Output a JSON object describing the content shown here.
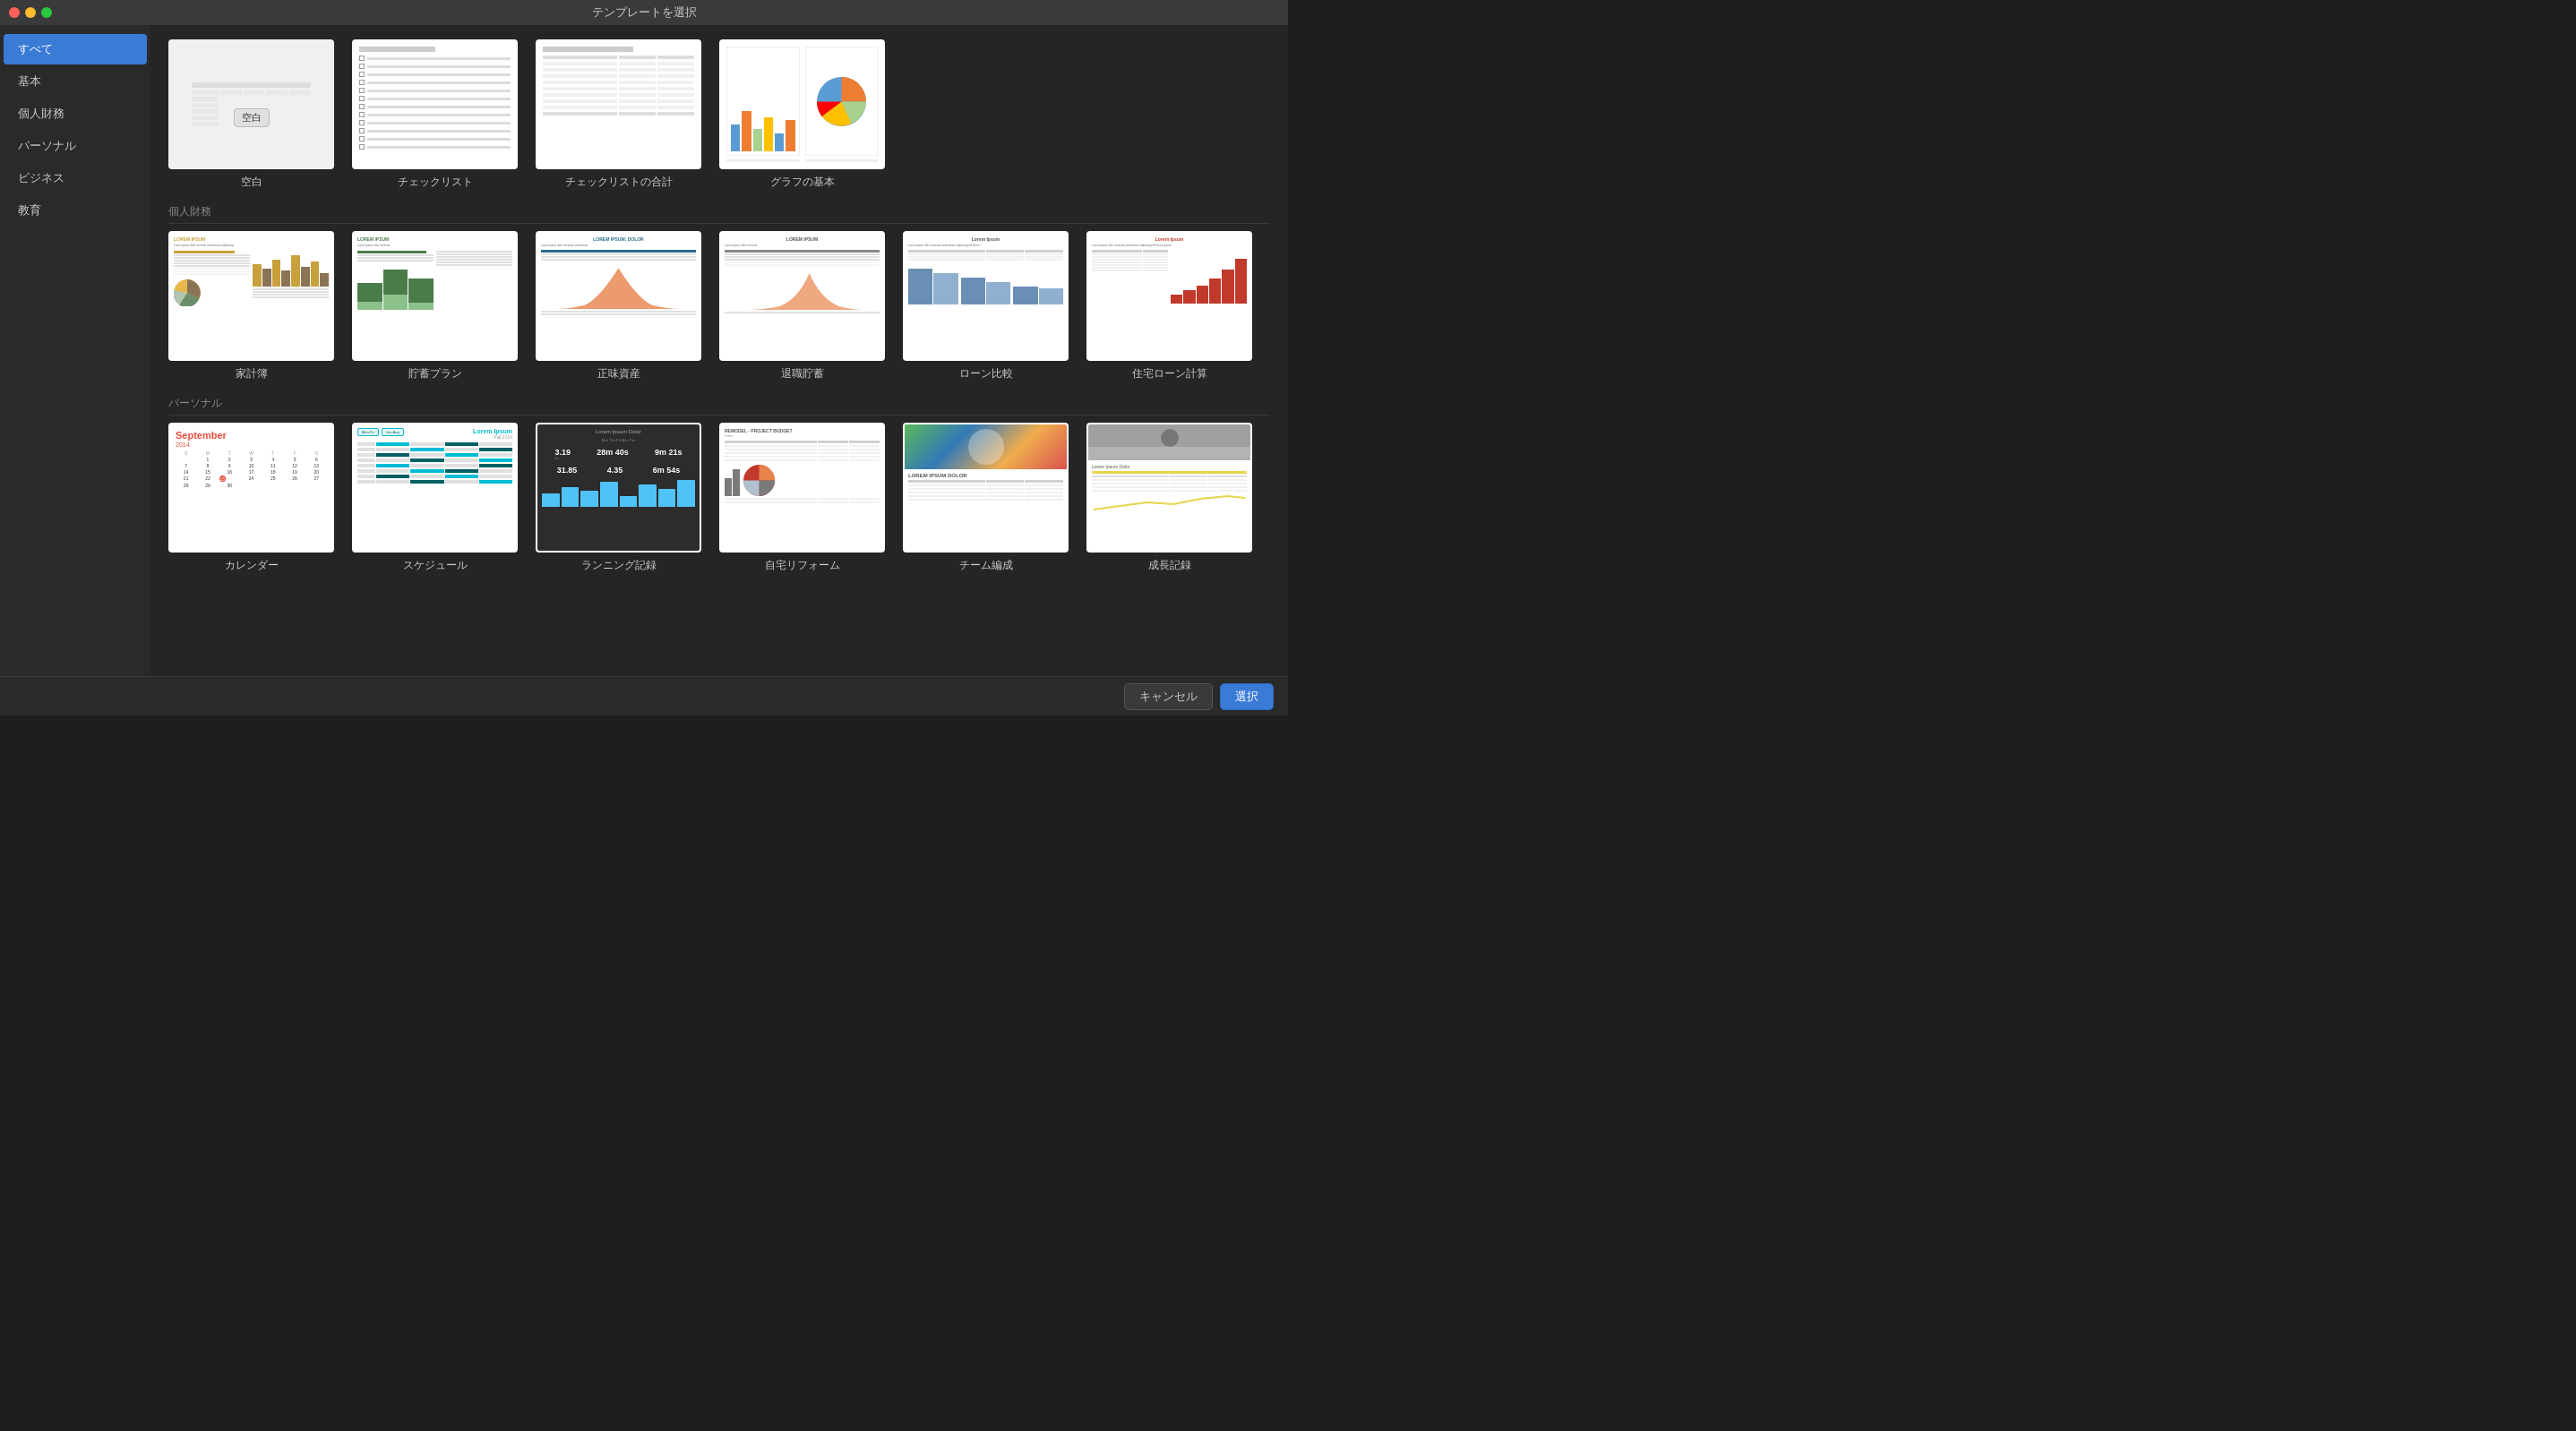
{
  "titlebar": {
    "title": "テンプレートを選択"
  },
  "sidebar": {
    "items": [
      {
        "id": "all",
        "label": "すべて",
        "active": true
      },
      {
        "id": "basic",
        "label": "基本",
        "active": false
      },
      {
        "id": "personal-finance",
        "label": "個人財務",
        "active": false
      },
      {
        "id": "personal",
        "label": "パーソナル",
        "active": false
      },
      {
        "id": "business",
        "label": "ビジネス",
        "active": false
      },
      {
        "id": "education",
        "label": "教育",
        "active": false
      }
    ]
  },
  "sections": {
    "basic": {
      "label": null,
      "templates": [
        {
          "id": "blank",
          "label": "空白"
        },
        {
          "id": "checklist",
          "label": "チェックリスト"
        },
        {
          "id": "checklist-sum",
          "label": "チェックリストの合計"
        },
        {
          "id": "graph-basics",
          "label": "グラフの基本"
        }
      ]
    },
    "personal_finance": {
      "label": "個人財務",
      "templates": [
        {
          "id": "household",
          "label": "家計簿"
        },
        {
          "id": "savings",
          "label": "貯蓄プラン"
        },
        {
          "id": "net-assets",
          "label": "正味資産"
        },
        {
          "id": "retirement",
          "label": "退職貯蓄"
        },
        {
          "id": "loan-compare",
          "label": "ローン比較"
        },
        {
          "id": "mortgage",
          "label": "住宅ローン計算"
        }
      ]
    },
    "personal": {
      "label": "パーソナル",
      "templates": [
        {
          "id": "calendar",
          "label": "カレンダー"
        },
        {
          "id": "schedule",
          "label": "スケジュール"
        },
        {
          "id": "running",
          "label": "ランニング記録"
        },
        {
          "id": "remodel",
          "label": "自宅リフォーム"
        },
        {
          "id": "team",
          "label": "チーム編成"
        },
        {
          "id": "growth",
          "label": "成長記録"
        }
      ]
    }
  },
  "footer": {
    "cancel_label": "キャンセル",
    "select_label": "選択"
  },
  "lorem": "LOREM IPSUM",
  "lorem_dolor": "LOREM IPSUM: DOLOR",
  "lorem_ipsum_dolor": "Lorem Ipsum Dolor"
}
